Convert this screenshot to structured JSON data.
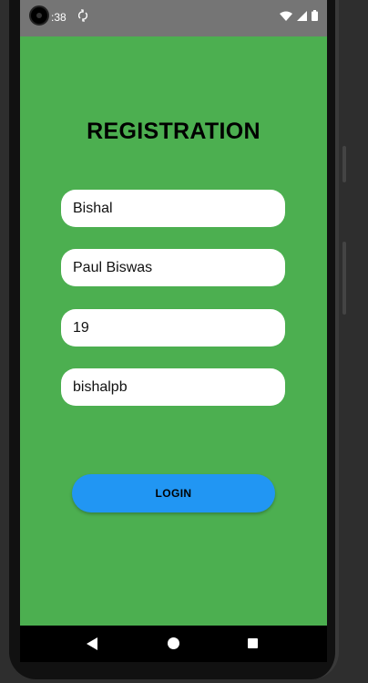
{
  "status_bar": {
    "time": ":38",
    "sync_icon": "sync-icon",
    "icons": [
      "wifi-icon",
      "signal-icon",
      "battery-icon"
    ]
  },
  "form": {
    "title": "REGISTRATION",
    "fields": [
      {
        "name": "first-name",
        "value": "Bishal"
      },
      {
        "name": "last-name",
        "value": "Paul Biswas"
      },
      {
        "name": "age",
        "value": "19"
      },
      {
        "name": "username",
        "value": "bishalpb"
      }
    ],
    "button_label": "LOGIN"
  },
  "colors": {
    "background": "#4caf50",
    "button": "#2196f3",
    "status_bar": "#757575"
  },
  "nav": {
    "icons": [
      "back-icon",
      "home-icon",
      "recents-icon"
    ]
  }
}
